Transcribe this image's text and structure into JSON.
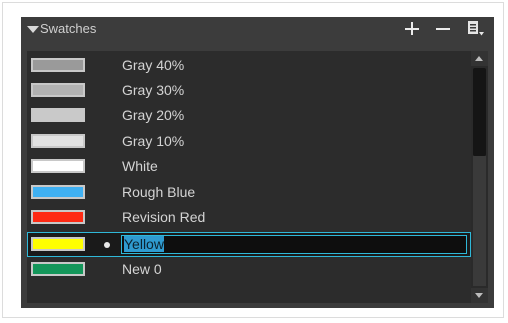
{
  "header": {
    "title": "Swatches",
    "collapse_icon": "triangle-down-icon",
    "add_icon": "plus-icon",
    "remove_icon": "minus-icon",
    "menu_icon": "panel-menu-icon"
  },
  "swatches": [
    {
      "name": "Gray 40%",
      "color": "#9a9a9a"
    },
    {
      "name": "Gray 30%",
      "color": "#b2b2b2"
    },
    {
      "name": "Gray 20%",
      "color": "#c9c9c9"
    },
    {
      "name": "Gray 10%",
      "color": "#e1e1e1"
    },
    {
      "name": "White",
      "color": "#ffffff"
    },
    {
      "name": "Rough Blue",
      "color": "#3fb0f2"
    },
    {
      "name": "Revision Red",
      "color": "#ff2a14"
    },
    {
      "name": "Yellow",
      "color": "#ffff00",
      "selected": true,
      "editing_value": "Yellow"
    },
    {
      "name": "New 0",
      "color": "#14965a"
    }
  ],
  "colors": {
    "panel_bg": "#3c3c3c",
    "list_bg": "#2c2c2c",
    "selection_border": "#2fb8d8"
  }
}
